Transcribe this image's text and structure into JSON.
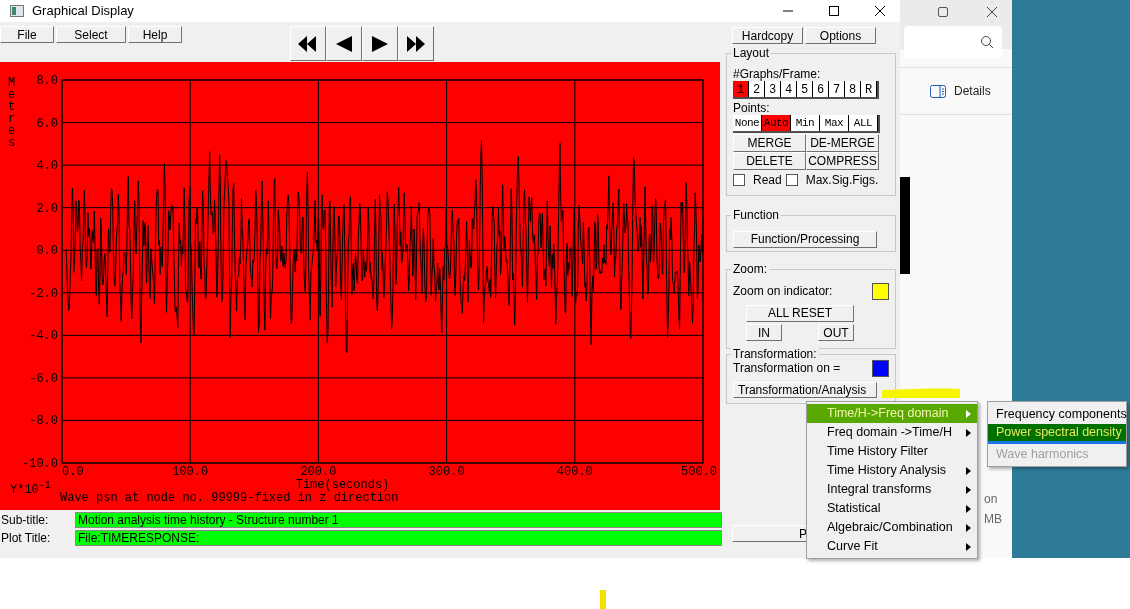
{
  "window": {
    "title": "Graphical Display"
  },
  "menu_bar": [
    "File",
    "Select",
    "Help"
  ],
  "nav_buttons": [
    {
      "kind": "first"
    },
    {
      "kind": "previous"
    },
    {
      "kind": "next"
    },
    {
      "kind": "last"
    }
  ],
  "plot": {
    "ylabel": "Metres",
    "yticks": [
      "8.0",
      "6.0",
      "4.0",
      "2.0",
      "0.0",
      "-2.0",
      "-4.0",
      "-6.0",
      "-8.0",
      "-10.0"
    ],
    "xticks": [
      "0.0",
      "100.0",
      "200.0",
      "300.0",
      "400.0",
      "500.0"
    ],
    "xlabel": "Time(seconds)",
    "multiplier": {
      "base": "Y*10",
      "exponent": "-1"
    },
    "caption": "Wave psn at node no. 99999-fixed  in z direction"
  },
  "fields": [
    {
      "label": "Sub-title:",
      "value": "Motion analysis time history - Structure number 1"
    },
    {
      "label": "Plot Title:",
      "value": "File:TIMERESPONSE:"
    }
  ],
  "panel": {
    "top_buttons": [
      "Hardcopy",
      "Options"
    ],
    "layout": {
      "title": "Layout",
      "graphs_label": "#Graphs/Frame:",
      "graphs": [
        {
          "label": "1",
          "selected": true
        },
        {
          "label": "2",
          "selected": false
        },
        {
          "label": "3",
          "selected": false
        },
        {
          "label": "4",
          "selected": false
        },
        {
          "label": "5",
          "selected": false
        },
        {
          "label": "6",
          "selected": false
        },
        {
          "label": "7",
          "selected": false
        },
        {
          "label": "8",
          "selected": false
        },
        {
          "label": "R",
          "selected": false
        }
      ],
      "points_label": "Points:",
      "points": [
        {
          "label": "None",
          "selected": false
        },
        {
          "label": "Auto",
          "selected": true
        },
        {
          "label": "Min",
          "selected": false
        },
        {
          "label": "Max",
          "selected": false
        },
        {
          "label": "ALL",
          "selected": false
        }
      ],
      "actions": [
        "MERGE",
        "DE-MERGE",
        "DELETE",
        "COMPRESS"
      ],
      "checkboxes": [
        {
          "label": "Read",
          "checked": false
        },
        {
          "label": "Max.Sig.Figs.",
          "checked": false
        }
      ]
    },
    "function": {
      "title": "Function",
      "button": "Function/Processing"
    },
    "zoom": {
      "title": "Zoom:",
      "indicator_label": "Zoom on indicator:",
      "color": "#ffff00",
      "reset": "ALL  RESET",
      "in": "IN",
      "out": "OUT"
    },
    "transformation": {
      "title": "Transformation:",
      "indicator_label": "Transformation on =",
      "color": "#0000ff",
      "button": "Transformation/Analysis"
    },
    "bottom_button": "P"
  },
  "context_menu": [
    {
      "label": "Time/H->Freq domain",
      "submenu": true,
      "selected": true
    },
    {
      "label": "Freq domain ->Time/H",
      "submenu": true,
      "selected": false
    },
    {
      "label": "Time History Filter",
      "submenu": false,
      "selected": false
    },
    {
      "label": "Time History Analysis",
      "submenu": true,
      "selected": false
    },
    {
      "label": "Integral transforms",
      "submenu": true,
      "selected": false
    },
    {
      "label": "Statistical",
      "submenu": true,
      "selected": false
    },
    {
      "label": "Algebraic/Combination",
      "submenu": true,
      "selected": false
    },
    {
      "label": "Curve Fit",
      "submenu": true,
      "selected": false
    }
  ],
  "submenu": [
    {
      "label": "Frequency components",
      "selected": false,
      "disabled": false
    },
    {
      "label": "Power spectral density",
      "selected": true,
      "disabled": false
    },
    {
      "label": "Wave harmonics",
      "selected": false,
      "disabled": true
    }
  ],
  "explorer": {
    "details": "Details",
    "partial_texts": [
      "on",
      "MB"
    ]
  }
}
